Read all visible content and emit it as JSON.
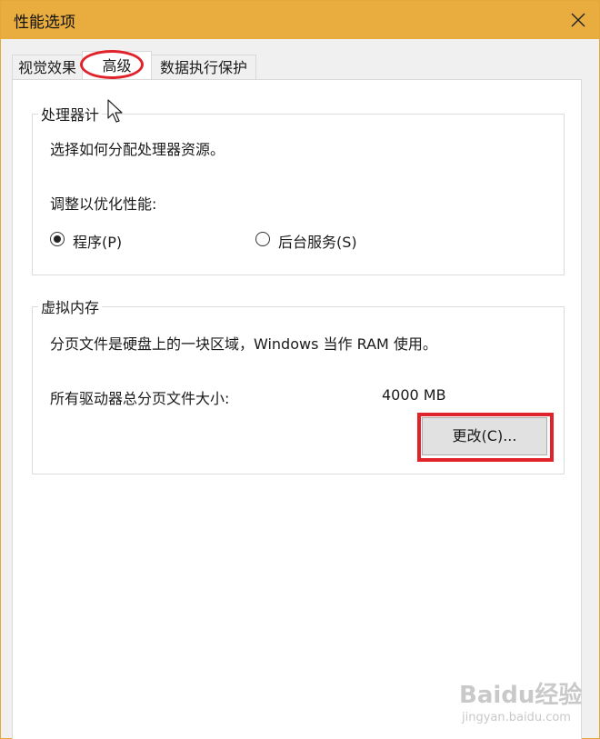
{
  "window": {
    "title": "性能选项"
  },
  "tabs": [
    {
      "label": "视觉效果"
    },
    {
      "label": "高级"
    },
    {
      "label": "数据执行保护"
    }
  ],
  "processor_group": {
    "legend": "处理器计",
    "description": "选择如何分配处理器资源。",
    "adjust_label": "调整以优化性能:",
    "options": [
      {
        "label": "程序(P)",
        "selected": true
      },
      {
        "label": "后台服务(S)",
        "selected": false
      }
    ]
  },
  "virtual_memory_group": {
    "legend": "虚拟内存",
    "description": "分页文件是硬盘上的一块区域，Windows 当作 RAM 使用。",
    "total_label": "所有驱动器总分页文件大小:",
    "total_value": "4000 MB",
    "change_button": "更改(C)..."
  },
  "watermark": {
    "brand": "Baidu 经验",
    "url": "jingyan.baidu.com"
  },
  "colors": {
    "titlebar": "#e8ac3f",
    "highlight": "#e0232a"
  }
}
